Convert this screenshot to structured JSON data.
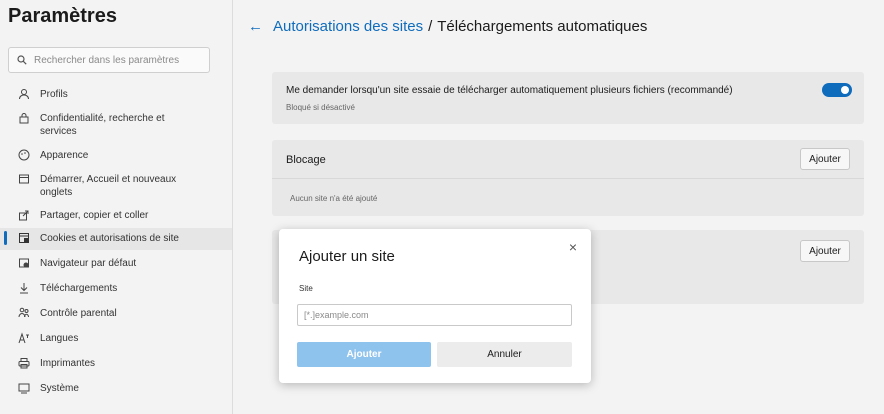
{
  "sidebar": {
    "title": "Paramètres",
    "search_placeholder": "Rechercher dans les paramètres",
    "items": [
      {
        "label": "Profils",
        "icon": "profile-icon"
      },
      {
        "label": "Confidentialité, recherche et services",
        "icon": "lock-icon"
      },
      {
        "label": "Apparence",
        "icon": "appearance-icon"
      },
      {
        "label": "Démarrer, Accueil et nouveaux onglets",
        "icon": "home-tab-icon"
      },
      {
        "label": "Partager, copier et coller",
        "icon": "share-icon"
      },
      {
        "label": "Cookies et autorisations de site",
        "icon": "site-permissions-icon",
        "active": true
      },
      {
        "label": "Navigateur par défaut",
        "icon": "default-browser-icon"
      },
      {
        "label": "Téléchargements",
        "icon": "download-icon"
      },
      {
        "label": "Contrôle parental",
        "icon": "family-icon"
      },
      {
        "label": "Langues",
        "icon": "language-icon"
      },
      {
        "label": "Imprimantes",
        "icon": "printer-icon"
      },
      {
        "label": "Système",
        "icon": "system-icon"
      }
    ]
  },
  "header": {
    "breadcrumb_link": "Autorisations des sites",
    "separator": "/",
    "current": "Téléchargements automatiques"
  },
  "setting": {
    "title": "Me demander lorsqu'un site essaie de télécharger automatiquement plusieurs fichiers (recommandé)",
    "subtitle": "Bloqué si désactivé",
    "toggle_on": true
  },
  "block_section": {
    "heading": "Blocage",
    "add_label": "Ajouter",
    "empty_text": "Aucun site n'a été ajouté"
  },
  "allow_section": {
    "add_label": "Ajouter"
  },
  "dialog": {
    "title": "Ajouter un site",
    "close": "×",
    "field_label": "Site",
    "field_placeholder": "[*.]example.com",
    "add_label": "Ajouter",
    "cancel_label": "Annuler"
  },
  "colors": {
    "accent": "#0f6cbd",
    "disabled_button": "#8ec3ee"
  }
}
